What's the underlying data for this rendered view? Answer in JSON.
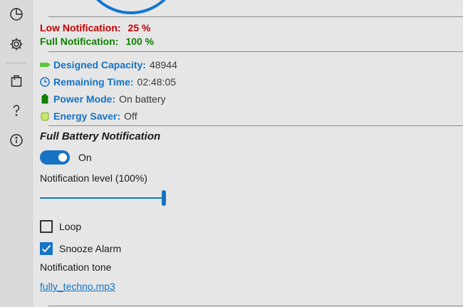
{
  "sidebar": {
    "items": [
      {
        "icon": "pie-chart-icon"
      },
      {
        "icon": "gear-icon"
      },
      {
        "icon": "shopping-bag-icon"
      },
      {
        "icon": "help-icon"
      },
      {
        "icon": "info-icon"
      }
    ]
  },
  "notifications": {
    "low_label": "Low Notification:",
    "low_value": "25 %",
    "full_label": "Full Notification:",
    "full_value": "100 %"
  },
  "battery_info": [
    {
      "icon": "battery-capacity-icon",
      "label": "Designed Capacity:",
      "value": "48944"
    },
    {
      "icon": "clock-icon",
      "label": "Remaining Time:",
      "value": "02:48:05"
    },
    {
      "icon": "battery-icon",
      "label": "Power Mode:",
      "value": "On battery"
    },
    {
      "icon": "energy-saver-icon",
      "label": "Energy Saver:",
      "value": "Off"
    }
  ],
  "full_battery": {
    "title": "Full Battery Notification",
    "toggle_label": "On",
    "toggle_on": true,
    "level_label": "Notification level (100%)",
    "level_fraction": 1.0,
    "loop_label": "Loop",
    "loop_checked": false,
    "snooze_label": "Snooze Alarm",
    "snooze_checked": true,
    "tone_label": "Notification tone",
    "tone_file": "fully_techno.mp3"
  },
  "colors": {
    "accent": "#1673c4",
    "low": "#c40000",
    "full": "#108000"
  }
}
